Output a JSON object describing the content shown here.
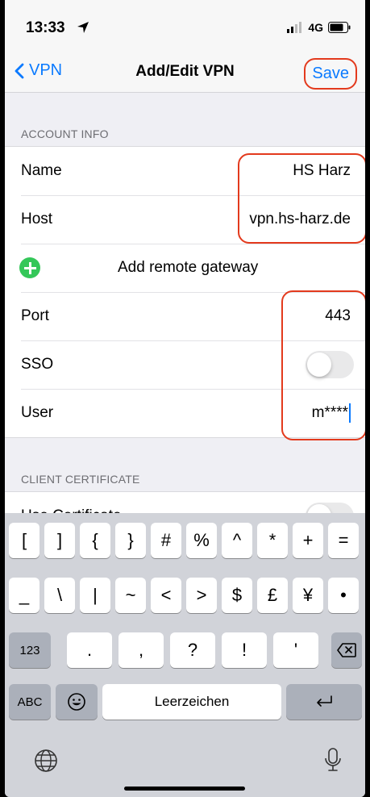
{
  "status": {
    "time": "13:33",
    "network": "4G"
  },
  "nav": {
    "back_label": "VPN",
    "title": "Add/Edit VPN",
    "save_label": "Save"
  },
  "account": {
    "header": "ACCOUNT INFO",
    "name_label": "Name",
    "name_value": "HS Harz",
    "host_label": "Host",
    "host_value": "vpn.hs-harz.de",
    "add_gateway_label": "Add remote gateway",
    "port_label": "Port",
    "port_value": "443",
    "sso_label": "SSO",
    "sso_on": false,
    "user_label": "User",
    "user_value": "m****"
  },
  "certificate": {
    "header": "CLIENT CERTIFICATE",
    "use_cert_label": "Use Certificate"
  },
  "keyboard": {
    "row1": [
      "[",
      "]",
      "{",
      "}",
      "#",
      "%",
      "^",
      "*",
      "+",
      "="
    ],
    "row2": [
      "_",
      "\\",
      "|",
      "~",
      "<",
      ">",
      "$",
      "£",
      "¥",
      "•"
    ],
    "row3_left": "123",
    "row3": [
      ".",
      ",",
      "?",
      "!",
      "'"
    ],
    "abc_label": "ABC",
    "space_label": "Leerzeichen"
  },
  "colors": {
    "accent": "#0a7aff",
    "highlight": "#e33a1d",
    "add_green": "#34c759"
  }
}
